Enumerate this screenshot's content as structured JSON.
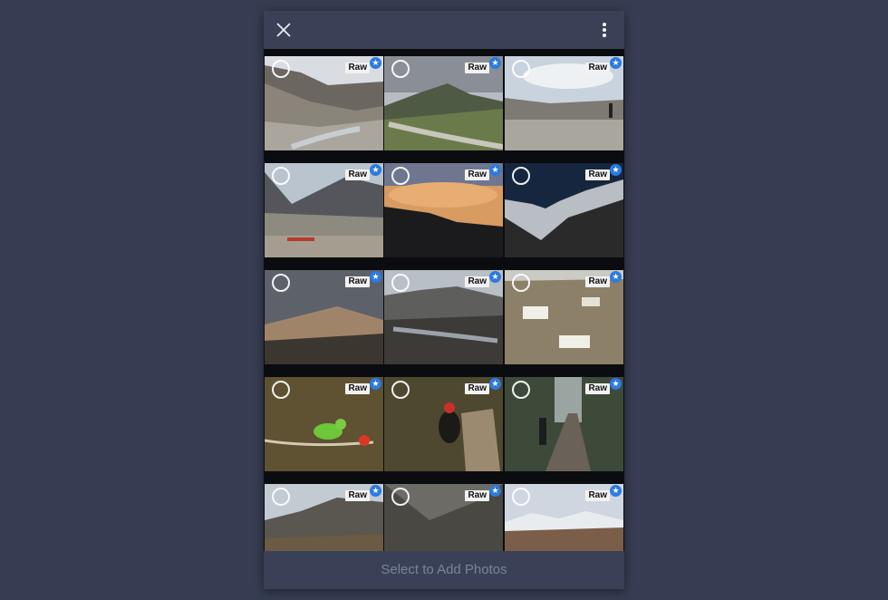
{
  "header": {
    "close_icon": "close-icon",
    "menu_icon": "more-vertical-icon"
  },
  "photos": [
    {
      "badge": "Raw",
      "scene": "mountain valley with river"
    },
    {
      "badge": "Raw",
      "scene": "cloudy sky over green hills and road"
    },
    {
      "badge": "Raw",
      "scene": "hiker on plain with sheep"
    },
    {
      "badge": "Raw",
      "scene": "mountains with village below"
    },
    {
      "badge": "Raw",
      "scene": "orange sunset clouds over ridge"
    },
    {
      "badge": "Raw",
      "scene": "snow peak at night"
    },
    {
      "badge": "Raw",
      "scene": "stormy sky over lit ridge"
    },
    {
      "badge": "Raw",
      "scene": "braided river in valley"
    },
    {
      "badge": "Raw",
      "scene": "white houses on hillside"
    },
    {
      "badge": "Raw",
      "scene": "green bird on branch"
    },
    {
      "badge": "Raw",
      "scene": "woodpecker on stump"
    },
    {
      "badge": "Raw",
      "scene": "cyclist on forest road"
    },
    {
      "badge": "Raw",
      "scene": "mountain slopes"
    },
    {
      "badge": "Raw",
      "scene": "rocky valley"
    },
    {
      "badge": "Raw",
      "scene": "snow-capped range"
    }
  ],
  "footer": {
    "action_label": "Select to Add Photos"
  },
  "colors": {
    "bar": "#3a4157",
    "page_background": "#363d52",
    "badge_star": "#2d7ae0",
    "footer_text": "#7b8396"
  }
}
